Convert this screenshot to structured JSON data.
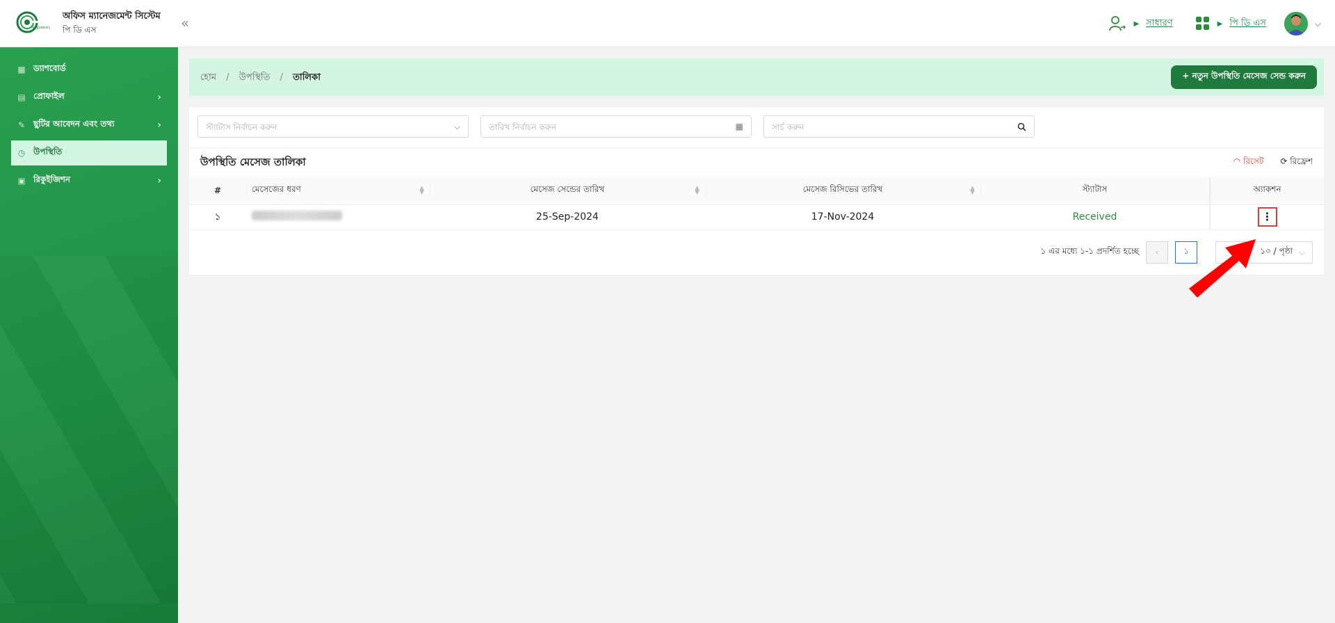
{
  "header": {
    "title": "অফিস ম্যানেজমেন্ট সিস্টেম",
    "subtitle": "পি ডি এস",
    "collapse_icon": "double-chevron-left-icon",
    "role_label": "সাধারণ",
    "module_label": "পি ডি এস"
  },
  "sidebar": {
    "items": [
      {
        "label": "ড্যাশবোর্ড",
        "icon": "dashboard-icon"
      },
      {
        "label": "প্রোফাইল",
        "icon": "profile-icon"
      },
      {
        "label": "ছুটির আবেদন এবং তথ্য",
        "icon": "leave-icon"
      },
      {
        "label": "উপস্থিতি",
        "icon": "clock-icon"
      },
      {
        "label": "রিকুইজিশন",
        "icon": "requisition-icon"
      }
    ]
  },
  "breadcrumb": {
    "home": "হোম",
    "section": "উপস্থিতি",
    "current": "তালিকা"
  },
  "new_button": "+ নতুন উপস্থিতি মেসেজ সেন্ড করুন",
  "filters": {
    "status_placeholder": "স্ট্যাটাস নির্বাচন করুন",
    "date_placeholder": "তারিখ নির্বাচন করুন",
    "search_placeholder": "সার্চ করুন"
  },
  "table": {
    "title": "উপস্থিতি মেসেজ তালিকা",
    "reset": "রিসেট",
    "refresh": "রিফ্রেশ",
    "columns": [
      "#",
      "মেসেজের ধরণ",
      "মেসেজ সেন্ডের তারিখ",
      "মেসেজ রিসিভের তারিখ",
      "স্ট্যাটাস",
      "অ্যাকশন"
    ],
    "rows": [
      {
        "index": "১",
        "type": "",
        "sent": "25-Sep-2024",
        "received": "17-Nov-2024",
        "status": "Received"
      }
    ]
  },
  "pagination": {
    "summary": "১ এর মধ্যে ১-১ প্রদর্শিত হচ্ছে",
    "current_page": "১",
    "page_size": "১০ / পৃষ্ঠা"
  },
  "colors": {
    "brand_green": "#1f7a3e",
    "sidebar_green": "#22994a",
    "active_bg": "#d4f5e1",
    "status_green": "#2e8b3e",
    "alert_red": "#e53935"
  }
}
